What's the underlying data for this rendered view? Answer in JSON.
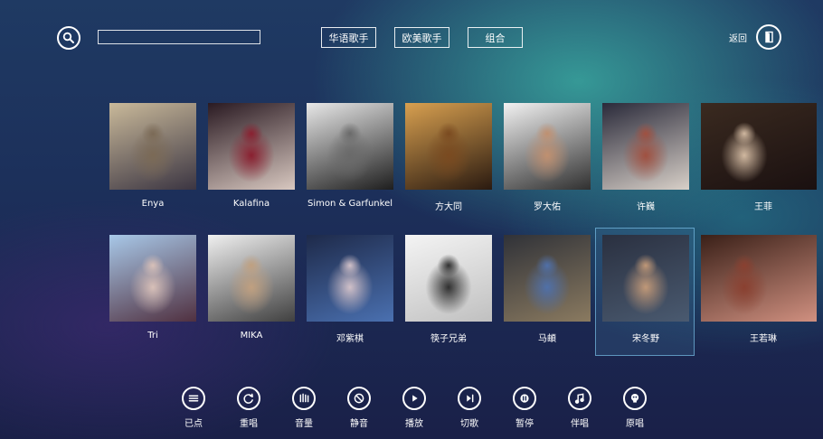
{
  "header": {
    "search": {
      "placeholder": "",
      "value": ""
    },
    "filters": [
      "华语歌手",
      "欧美歌手",
      "组合"
    ],
    "back_label": "返回"
  },
  "artists": [
    {
      "name": "Enya",
      "tones": [
        "#c9b99a",
        "#7b6a56",
        "#3b3542"
      ]
    },
    {
      "name": "Kalafina",
      "tones": [
        "#2a1a22",
        "#8a2030",
        "#d8c8c0"
      ]
    },
    {
      "name": "Simon & Garfunkel",
      "tones": [
        "#e8e8e8",
        "#6a6a6a",
        "#1e1e1e"
      ]
    },
    {
      "name": "方大同",
      "tones": [
        "#d8a050",
        "#7a4a20",
        "#2a1a10"
      ]
    },
    {
      "name": "罗大佑",
      "tones": [
        "#f2f2f2",
        "#c09070",
        "#303030"
      ]
    },
    {
      "name": "许巍",
      "tones": [
        "#2a2a3a",
        "#a05040",
        "#d8d0c8"
      ]
    },
    {
      "name": "王菲",
      "tones": [
        "#3a2a20",
        "#d0b8a0",
        "#1a1010"
      ]
    },
    {
      "name": "Tri",
      "tones": [
        "#a8c8e8",
        "#d8c0b8",
        "#503040"
      ]
    },
    {
      "name": "MIKA",
      "tones": [
        "#f0f0f0",
        "#c0a080",
        "#404040"
      ]
    },
    {
      "name": "邓紫棋",
      "tones": [
        "#1e2a4a",
        "#d0c0c8",
        "#4a70b0"
      ]
    },
    {
      "name": "筷子兄弟",
      "tones": [
        "#f4f4f4",
        "#303030",
        "#c0c0c0"
      ]
    },
    {
      "name": "马頔",
      "tones": [
        "#303238",
        "#5070a8",
        "#8a7a60"
      ]
    },
    {
      "name": "宋冬野",
      "tones": [
        "#2a3040",
        "#c09878",
        "#4a5a70"
      ]
    },
    {
      "name": "王若琳",
      "tones": [
        "#3a2018",
        "#8a4030",
        "#d09080"
      ]
    }
  ],
  "controls": [
    {
      "label": "已点",
      "icon": "list-icon"
    },
    {
      "label": "重唱",
      "icon": "replay-icon"
    },
    {
      "label": "音量",
      "icon": "volume-icon"
    },
    {
      "label": "静音",
      "icon": "mute-icon"
    },
    {
      "label": "播放",
      "icon": "play-icon"
    },
    {
      "label": "切歌",
      "icon": "skip-icon"
    },
    {
      "label": "暂停",
      "icon": "pause-icon"
    },
    {
      "label": "伴唱",
      "icon": "music-note-icon"
    },
    {
      "label": "原唱",
      "icon": "original-vocal-icon"
    }
  ],
  "selected_artist": "宋冬野"
}
